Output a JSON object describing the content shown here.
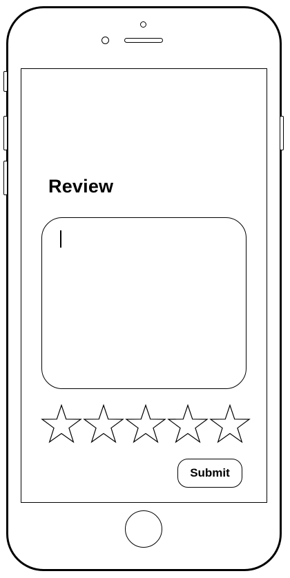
{
  "device": {
    "frame_icon": "iphone-outline",
    "home_button_icon": "home-button-circle"
  },
  "review": {
    "title": "Review",
    "input_value": "",
    "input_placeholder": ""
  },
  "rating": {
    "max": 5,
    "value": 0,
    "star_icon": "star-outline-icon"
  },
  "actions": {
    "submit_label": "Submit"
  }
}
